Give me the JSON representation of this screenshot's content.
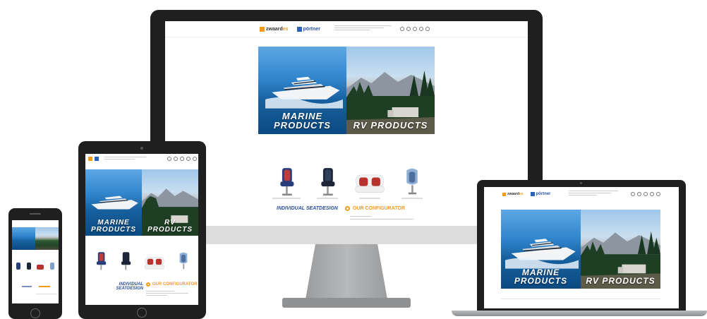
{
  "site": {
    "brand_a": "zwaard",
    "brand_a_suffix": "es",
    "brand_b": "pörtner",
    "hero_marine_line1": "MARINE",
    "hero_marine_line2": "PRODUCTS",
    "hero_rv_line1": "RV",
    "hero_rv_line2": "PRODUCTS",
    "seatdesign_line1": "INDIVIDUAL",
    "seatdesign_line2": "SEATDESIGN",
    "seatdesign": "INDIVIDUAL SEATDESIGN",
    "configurator": "OUR CONFIGURATOR",
    "products": [
      {
        "name": "blue-red-helm-seat"
      },
      {
        "name": "navy-helm-seat"
      },
      {
        "name": "white-red-bench-seat"
      },
      {
        "name": "blue-bucket-seat"
      }
    ]
  },
  "colors": {
    "accent_orange": "#f39a1e",
    "brand_blue": "#2a4f9a",
    "device_dark": "#1f1f1f",
    "stand_gray": "#a9abad"
  }
}
